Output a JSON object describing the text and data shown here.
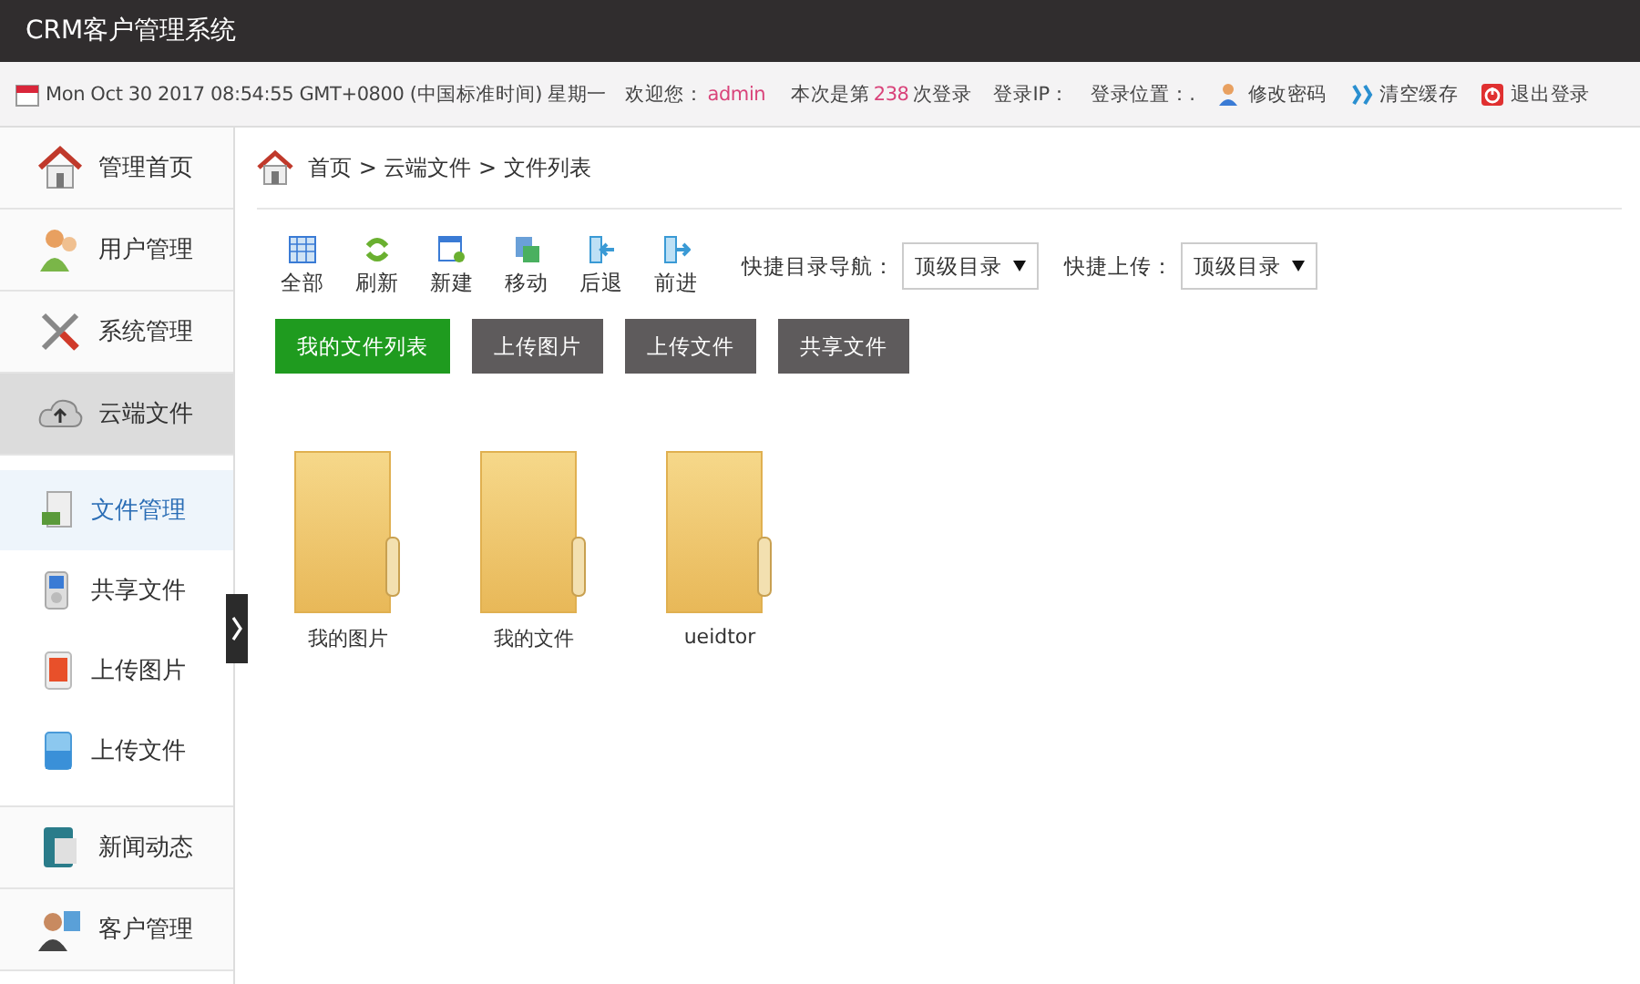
{
  "window": {
    "title": "CRM客户管理系统"
  },
  "info_bar": {
    "datetime": "Mon Oct 30 2017 08:54:55 GMT+0800 (中国标准时间) 星期一",
    "welcome_label": "欢迎您：",
    "username": "admin",
    "login_count_prefix": "本次是第",
    "login_count": "238",
    "login_count_suffix": "次登录",
    "login_ip": "登录IP：",
    "login_location": "登录位置：.",
    "actions": [
      {
        "label": "修改密码"
      },
      {
        "label": "清空缓存"
      },
      {
        "label": "退出登录"
      }
    ]
  },
  "sidebar": {
    "items": [
      {
        "label": "管理首页",
        "selected": false
      },
      {
        "label": "用户管理",
        "selected": false
      },
      {
        "label": "系统管理",
        "selected": false
      },
      {
        "label": "云端文件",
        "selected": true,
        "children": [
          {
            "label": "文件管理",
            "selected": true
          },
          {
            "label": "共享文件",
            "selected": false
          },
          {
            "label": "上传图片",
            "selected": false
          },
          {
            "label": "上传文件",
            "selected": false
          }
        ]
      },
      {
        "label": "新闻动态",
        "selected": false
      },
      {
        "label": "客户管理",
        "selected": false
      }
    ]
  },
  "breadcrumb": "首页 > 云端文件 > 文件列表",
  "toolbar": [
    {
      "label": "全部"
    },
    {
      "label": "刷新"
    },
    {
      "label": "新建"
    },
    {
      "label": "移动"
    },
    {
      "label": "后退"
    },
    {
      "label": "前进"
    }
  ],
  "quick_nav": {
    "label": "快捷目录导航：",
    "value": "顶级目录"
  },
  "quick_upload": {
    "label": "快捷上传：",
    "value": "顶级目录"
  },
  "tabs": [
    {
      "label": "我的文件列表",
      "selected": true
    },
    {
      "label": "上传图片",
      "selected": false
    },
    {
      "label": "上传文件",
      "selected": false
    },
    {
      "label": "共享文件",
      "selected": false
    }
  ],
  "folders": [
    {
      "name": "我的图片"
    },
    {
      "name": "我的文件"
    },
    {
      "name": "ueidtor"
    }
  ]
}
